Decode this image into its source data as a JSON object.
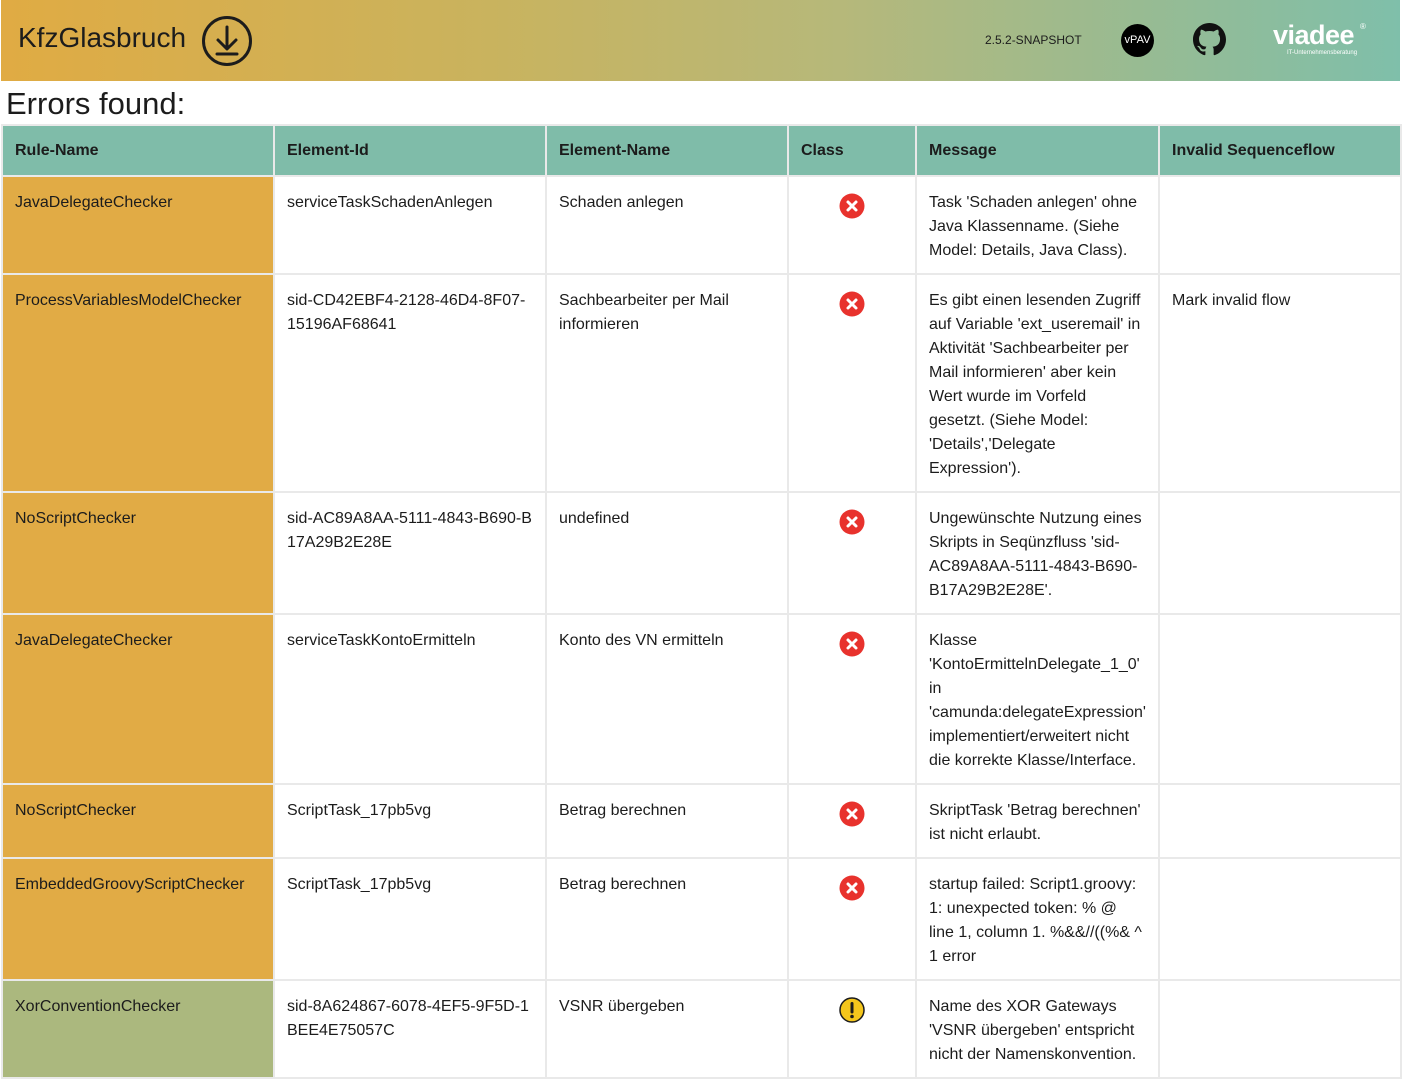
{
  "header": {
    "app_title": "KfzGlasbruch",
    "version": "2.5.2-SNAPSHOT",
    "vpav_label": "vPAV",
    "brand_name": "viadee",
    "brand_reg": "®",
    "brand_tagline": "IT-Unternehmensberatung"
  },
  "page_title": "Errors found:",
  "colors": {
    "error_row": "#e1ab45",
    "warning_row": "#abb87e",
    "table_header": "#7fbca9",
    "error_icon": "#e8322d",
    "warning_icon": "#f4c61c"
  },
  "table": {
    "columns": [
      "Rule-Name",
      "Element-Id",
      "Element-Name",
      "Class",
      "Message",
      "Invalid Sequenceflow"
    ],
    "rows": [
      {
        "rule": "JavaDelegateChecker",
        "element_id": "serviceTaskSchadenAnlegen",
        "element_name": "Schaden anlegen",
        "class": "error",
        "class_icon": "error-icon",
        "message": "Task 'Schaden anlegen' ohne Java Klassenname. (Siehe Model: Details, Java Class).",
        "invalid_flow": ""
      },
      {
        "rule": "ProcessVariablesModelChecker",
        "element_id": "sid-CD42EBF4-2128-46D4-8F07-15196AF68641",
        "element_name": "Sachbearbeiter per Mail informieren",
        "class": "error",
        "class_icon": "error-icon",
        "message": "Es gibt einen lesenden Zugriff auf Variable 'ext_useremail' in Aktivität 'Sachbearbeiter per Mail informieren' aber kein Wert wurde im Vorfeld gesetzt. (Siehe Model: 'Details','Delegate Expression').",
        "invalid_flow": "Mark invalid flow"
      },
      {
        "rule": "NoScriptChecker",
        "element_id": "sid-AC89A8AA-5111-4843-B690-B17A29B2E28E",
        "element_name": "undefined",
        "class": "error",
        "class_icon": "error-icon",
        "message": "Ungewünschte Nutzung eines Skripts in Seqünzfluss 'sid-AC89A8AA-5111-4843-B690-B17A29B2E28E'.",
        "invalid_flow": ""
      },
      {
        "rule": "JavaDelegateChecker",
        "element_id": "serviceTaskKontoErmitteln",
        "element_name": "Konto des VN ermitteln",
        "class": "error",
        "class_icon": "error-icon",
        "message": "Klasse 'KontoErmittelnDelegate_1_0' in 'camunda:delegateExpression' implementiert/erweitert nicht die korrekte Klasse/Interface.",
        "invalid_flow": ""
      },
      {
        "rule": "NoScriptChecker",
        "element_id": "ScriptTask_17pb5vg",
        "element_name": "Betrag berechnen",
        "class": "error",
        "class_icon": "error-icon",
        "message": "SkriptTask 'Betrag berechnen' ist nicht erlaubt.",
        "invalid_flow": ""
      },
      {
        "rule": "EmbeddedGroovyScriptChecker",
        "element_id": "ScriptTask_17pb5vg",
        "element_name": "Betrag berechnen",
        "class": "error",
        "class_icon": "error-icon",
        "message": "startup failed: Script1.groovy: 1: unexpected token: % @ line 1, column 1. %&&//((%& ^ 1 error",
        "invalid_flow": ""
      },
      {
        "rule": "XorConventionChecker",
        "element_id": "sid-8A624867-6078-4EF5-9F5D-1BEE4E75057C",
        "element_name": "VSNR übergeben",
        "class": "warning",
        "class_icon": "warning-icon",
        "message": "Name des XOR Gateways 'VSNR übergeben' entspricht nicht der Namenskonvention.",
        "invalid_flow": ""
      }
    ]
  }
}
